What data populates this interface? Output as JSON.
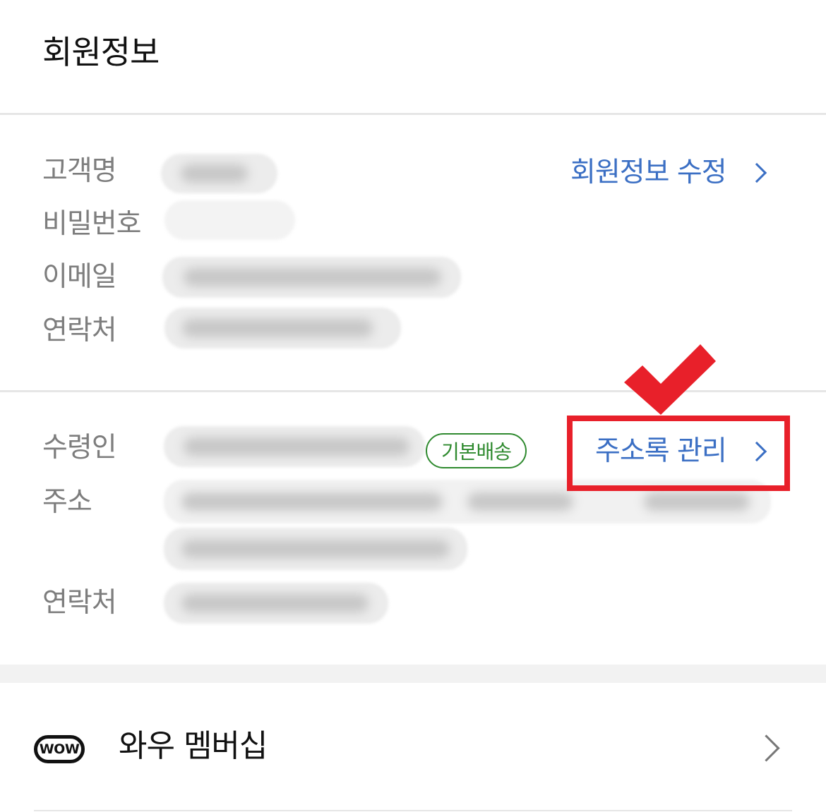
{
  "page_title": "회원정보",
  "member": {
    "labels": {
      "name": "고객명",
      "password": "비밀번호",
      "email": "이메일",
      "phone": "연락처"
    },
    "edit_link": "회원정보 수정"
  },
  "delivery": {
    "labels": {
      "recipient": "수령인",
      "address": "주소",
      "phone": "연락처"
    },
    "default_badge": "기본배송",
    "address_book_link": "주소록 관리"
  },
  "wow": {
    "badge": "WOW",
    "label": "와우 멤버십"
  },
  "colors": {
    "link": "#3b6fc4",
    "badge_green": "#2f8a2f",
    "annotation_red": "#e8202a"
  },
  "icons": {
    "link_chevron": "chevron-right-icon",
    "annotation": "check-mark-icon"
  }
}
